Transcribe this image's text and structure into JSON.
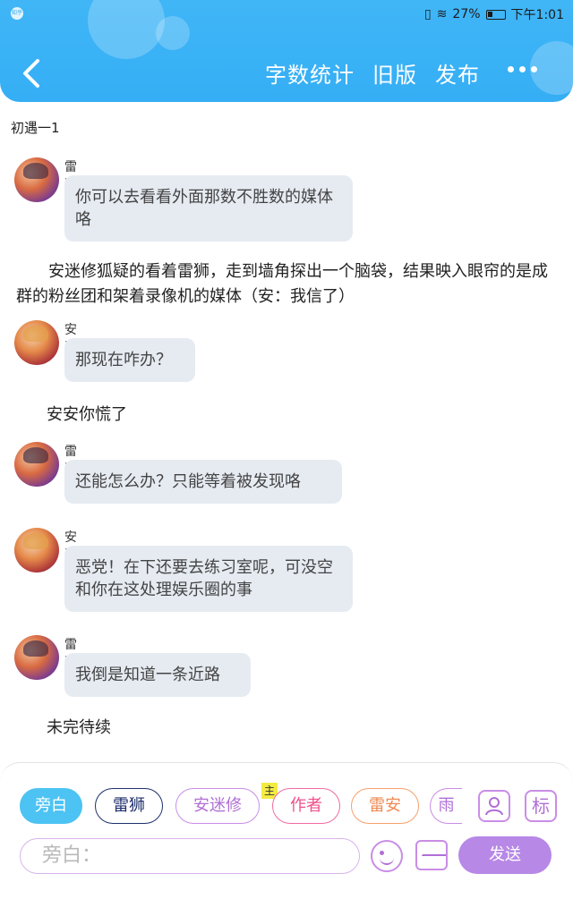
{
  "status_bar": {
    "app_badge": "知乎",
    "battery_percent": "27%",
    "time": "下午1:01"
  },
  "header": {
    "word_count": "字数统计",
    "old_version": "旧版",
    "publish": "发布"
  },
  "chapter_title": "初遇一1",
  "messages": [
    {
      "sender": "雷狮",
      "text": "你可以去看看外面那数不胜数的媒体咯"
    },
    {
      "sender": "安迷修",
      "text": "那现在咋办？"
    },
    {
      "sender": "雷狮",
      "text": "还能怎么办？只能等着被发现咯"
    },
    {
      "sender": "安迷修",
      "text": "恶党！在下还要去练习室呢，可没空和你在这处理娱乐圈的事"
    },
    {
      "sender": "雷狮",
      "text": "我倒是知道一条近路"
    }
  ],
  "narrations": [
    "安迷修狐疑的看着雷狮，走到墙角探出一个脑袋，结果映入眼帘的是成群的粉丝团和架着录像机的媒体（安：我信了）",
    "安安你慌了",
    "未完待续"
  ],
  "roles": {
    "narration": "旁白",
    "leishi": "雷狮",
    "anmixiu": "安迷修",
    "author": "作者",
    "leian": "雷安",
    "yu": "雨",
    "main_badge": "主",
    "tag_label": "标"
  },
  "input": {
    "placeholder": "旁白：",
    "send": "发送"
  },
  "colors": {
    "header": "#40b6f6",
    "bubble": "#e6ebf2",
    "send": "#b788e6",
    "accent_purple": "#c98de6"
  }
}
